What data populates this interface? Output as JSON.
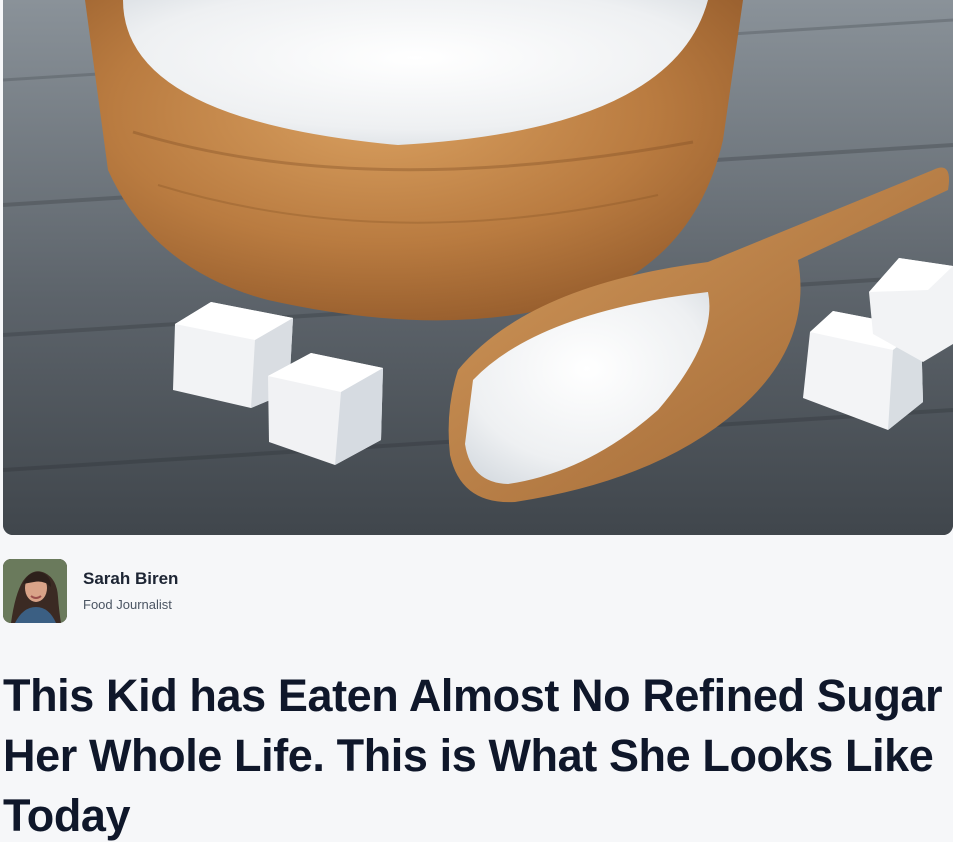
{
  "article": {
    "author": {
      "name": "Sarah Biren",
      "role": "Food Journalist"
    },
    "headline": "This Kid has Eaten Almost No Refined Sugar Her Whole Life. This is What She Looks Like Today"
  },
  "colors": {
    "background": "#f6f7f9",
    "headline": "#0f172a",
    "author_name": "#1d2534",
    "author_role": "#4b5563"
  },
  "icons": {
    "hero": "sugar-bowl-image",
    "avatar": "author-avatar"
  }
}
